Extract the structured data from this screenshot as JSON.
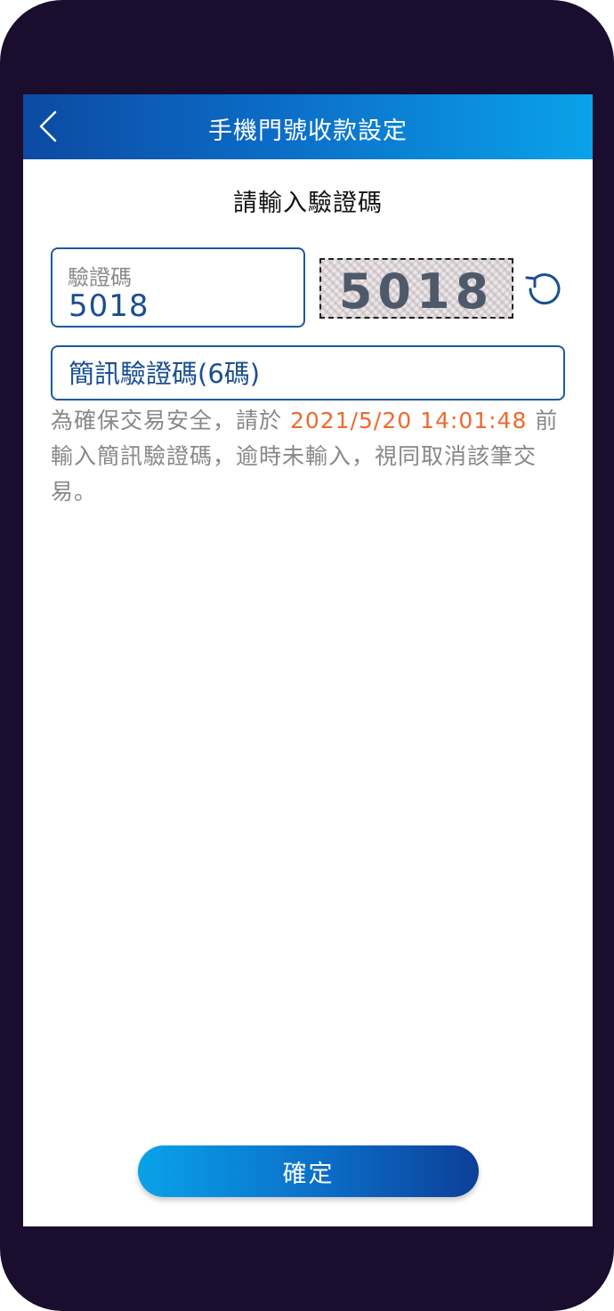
{
  "header": {
    "title": "手機門號收款設定",
    "back_icon": "chevron-left-icon"
  },
  "page": {
    "title": "請輸入驗證碼"
  },
  "captcha": {
    "label": "驗證碼",
    "value": "5018",
    "image_text": "5018",
    "refresh_icon": "refresh-icon"
  },
  "sms": {
    "placeholder": "簡訊驗證碼(6碼)",
    "value": ""
  },
  "notice": {
    "prefix": "為確保交易安全，請於 ",
    "deadline": "2021/5/20 14:01:48",
    "suffix": " 前輸入簡訊驗證碼，逾時未輸入，視同取消該筆交易。"
  },
  "actions": {
    "confirm_label": "確定"
  },
  "colors": {
    "accent": "#1a4f91",
    "header_gradient_start": "#0c4aa3",
    "header_gradient_end": "#0aa2e8",
    "deadline": "#ef6a2c",
    "frame": "#1b0d2d"
  }
}
